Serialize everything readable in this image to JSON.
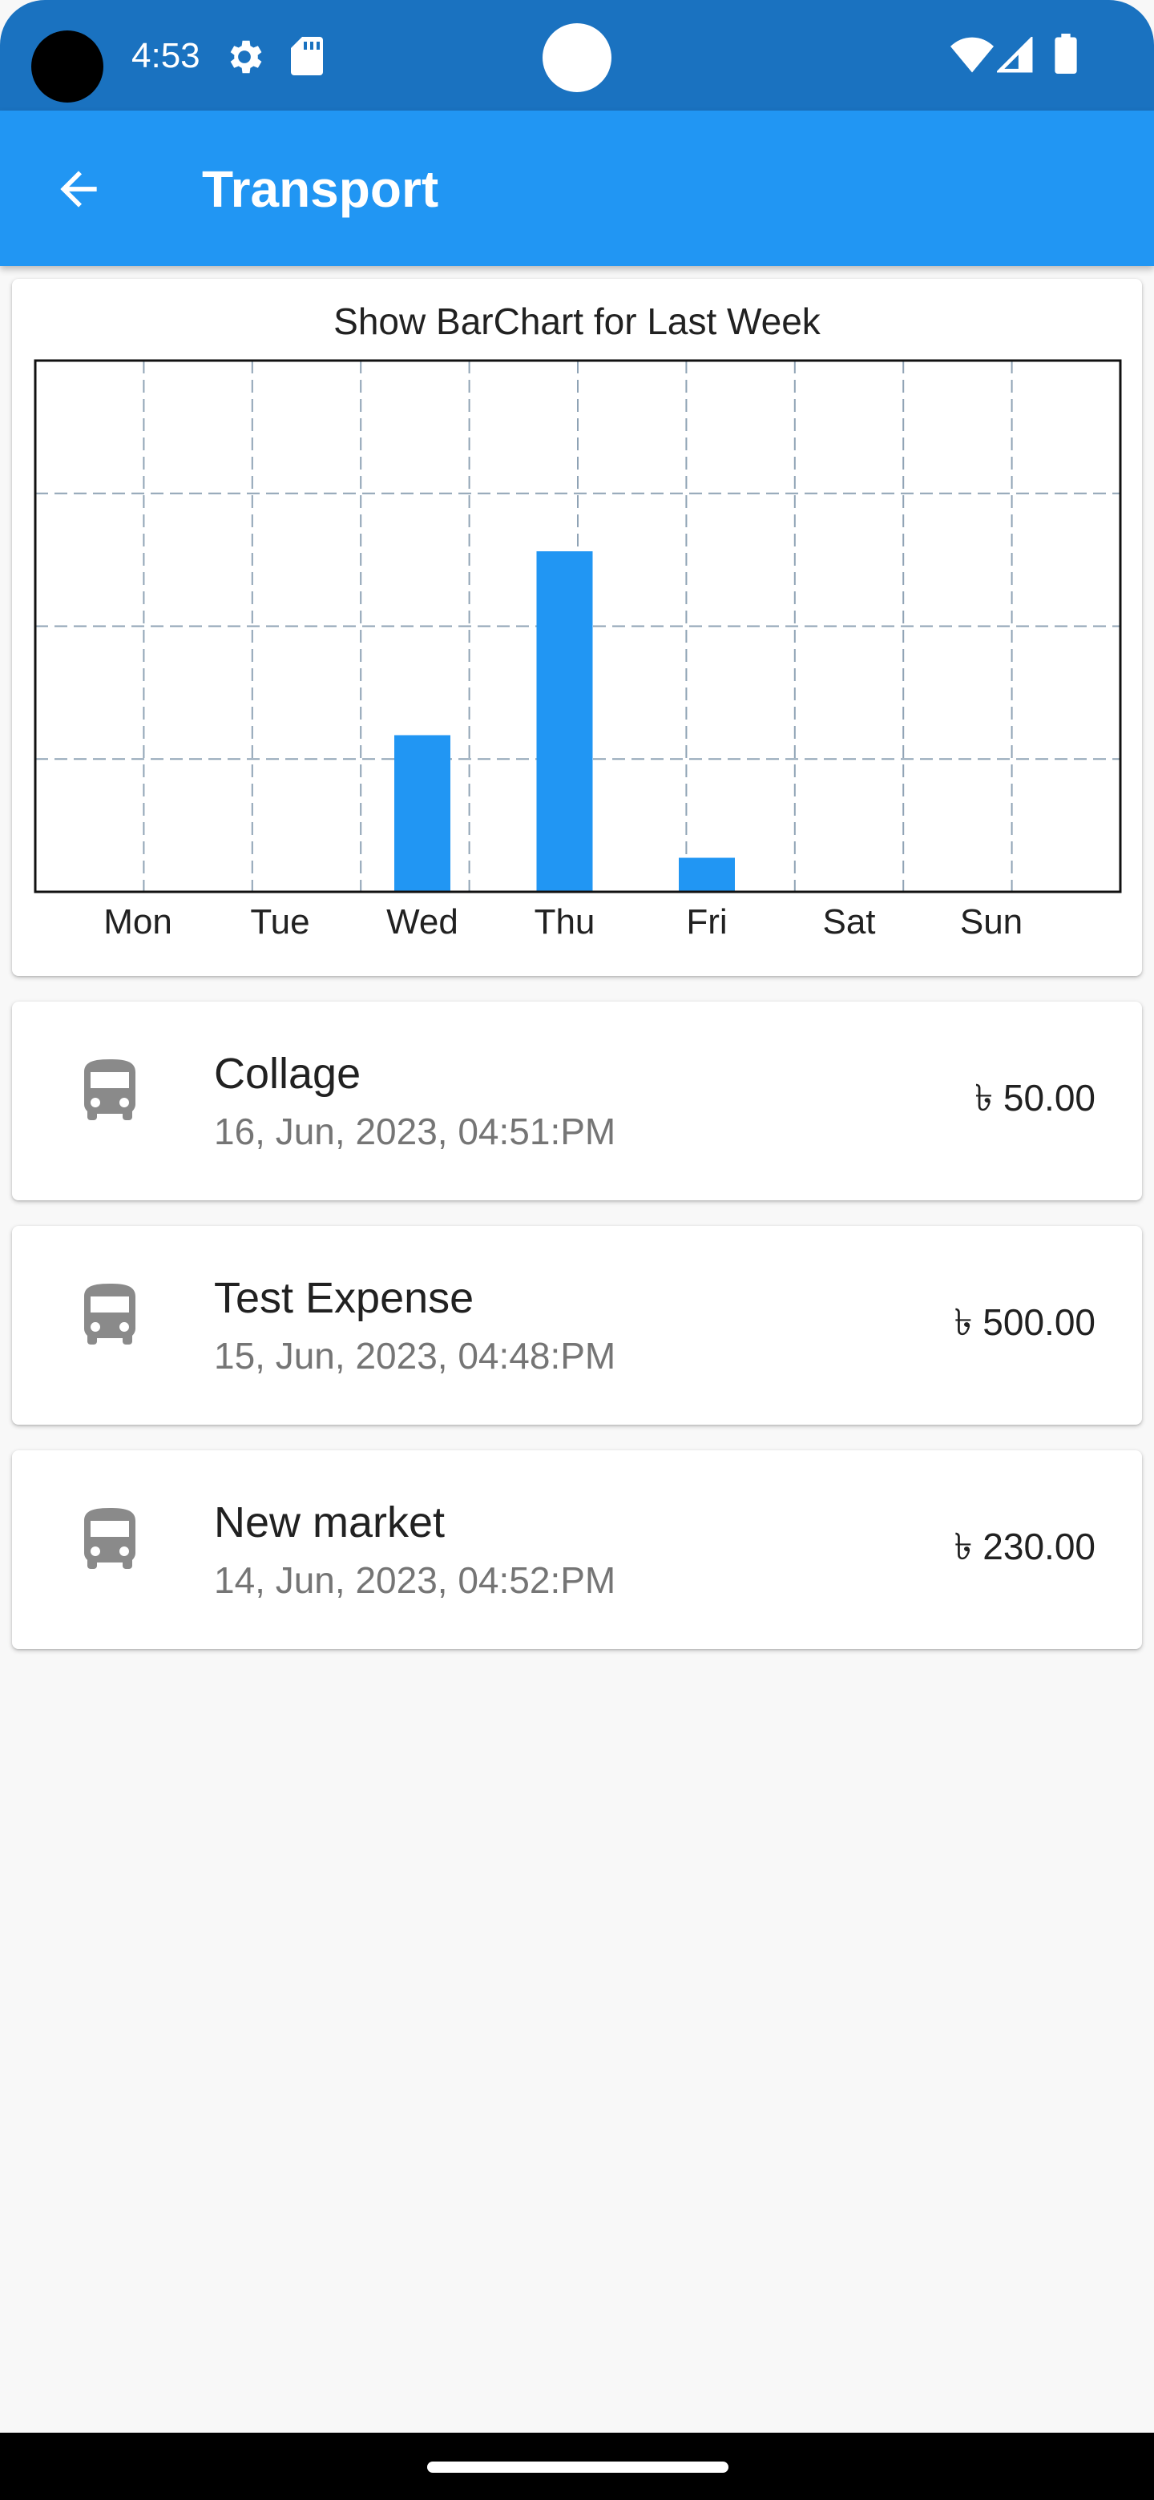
{
  "status_bar": {
    "time": "4:53",
    "icons": [
      "settings-icon",
      "sd-card-icon",
      "wifi-icon",
      "signal-icon",
      "battery-icon"
    ]
  },
  "app_bar": {
    "title": "Transport",
    "back_icon": "arrow-back-icon"
  },
  "chart_card": {
    "title": "Show BarChart for Last Week"
  },
  "chart_data": {
    "type": "bar",
    "categories": [
      "Mon",
      "Tue",
      "Wed",
      "Thu",
      "Fri",
      "Sat",
      "Sun"
    ],
    "values": [
      0,
      0,
      230,
      500,
      50,
      0,
      0
    ],
    "ylim": [
      0,
      780
    ],
    "grid": true,
    "bar_color": "#2196f3"
  },
  "expenses": [
    {
      "icon": "bus-icon",
      "title": "Collage",
      "date": "16, Jun, 2023, 04:51:PM",
      "amount": "৳ 50.00"
    },
    {
      "icon": "bus-icon",
      "title": "Test Expense",
      "date": "15, Jun, 2023, 04:48:PM",
      "amount": "৳ 500.00"
    },
    {
      "icon": "bus-icon",
      "title": "New market",
      "date": "14, Jun, 2023, 04:52:PM",
      "amount": "৳ 230.00"
    }
  ],
  "colors": {
    "status_bar": "#1a72c0",
    "app_bar": "#2196f3",
    "background": "#f8f8f8",
    "icon_grey": "#8a8a8a"
  }
}
